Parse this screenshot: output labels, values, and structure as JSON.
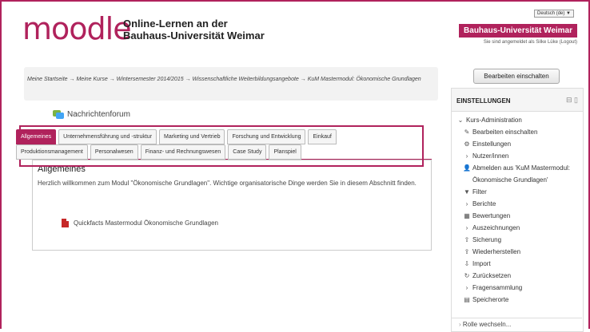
{
  "header": {
    "logo_text": "moodle",
    "logo_sub_line1": "Online-Lernen an der",
    "logo_sub_line2": "Bauhaus-Universität Weimar",
    "language": "Deutsch (de) ▼",
    "university": "Bauhaus-Universität Weimar",
    "login_info": "Sie sind angemeldet als Silke Lüke (Logout)"
  },
  "breadcrumb": {
    "text": "Meine Startseite → Meine Kurse → Wintersemester 2014/2015 → Wissenschaftliche Weiterbildungsangebote → KuM Mastermodul: Ökonomische Grundlagen"
  },
  "forum": {
    "label": "Nachrichtenforum"
  },
  "tabs": {
    "row1": [
      "Allgemeines",
      "Unternehmensführung und -struktur",
      "Marketing und Vertrieb",
      "Forschung und Entwicklung",
      "Einkauf"
    ],
    "row2": [
      "Produktionsmanagement",
      "Personalwesen",
      "Finanz- und Rechnungswesen",
      "Case Study",
      "Planspiel"
    ],
    "active": "Allgemeines"
  },
  "section": {
    "title": "Allgemeines",
    "text": "Herzlich willkommen zum Modul \"Ökonomische Grundlagen\". Wichtige organisatorische Dinge werden Sie in diesem Abschnitt finden.",
    "pdf_link": "Quickfacts Mastermodul Ökonomische Grundlagen"
  },
  "edit_button": "Bearbeiten einschalten",
  "settings": {
    "title": "EINSTELLUNGEN",
    "controls": "⊟ ▯",
    "items": [
      {
        "icon": "collapse-arrow",
        "glyph": "⌄",
        "label": "Kurs-Administration",
        "level": 0
      },
      {
        "icon": "pencil-icon",
        "glyph": "✎",
        "label": "Bearbeiten einschalten",
        "level": 1
      },
      {
        "icon": "gear-icon",
        "glyph": "⚙",
        "label": "Einstellungen",
        "level": 1
      },
      {
        "icon": "expand-arrow",
        "glyph": "›",
        "label": "Nutzer/innen",
        "level": 1
      },
      {
        "icon": "user-icon",
        "glyph": "👤",
        "label": "Abmelden aus 'KuM Mastermodul: Ökonomische Grundlagen'",
        "level": 1
      },
      {
        "icon": "filter-icon",
        "glyph": "▼",
        "label": "Filter",
        "level": 1
      },
      {
        "icon": "expand-arrow",
        "glyph": "›",
        "label": "Berichte",
        "level": 1
      },
      {
        "icon": "grades-icon",
        "glyph": "▦",
        "label": "Bewertungen",
        "level": 1
      },
      {
        "icon": "expand-arrow",
        "glyph": "›",
        "label": "Auszeichnungen",
        "level": 1
      },
      {
        "icon": "backup-icon",
        "glyph": "⇧",
        "label": "Sicherung",
        "level": 1
      },
      {
        "icon": "restore-icon",
        "glyph": "⇪",
        "label": "Wiederherstellen",
        "level": 1
      },
      {
        "icon": "import-icon",
        "glyph": "⇩",
        "label": "Import",
        "level": 1
      },
      {
        "icon": "reset-icon",
        "glyph": "↻",
        "label": "Zurücksetzen",
        "level": 1
      },
      {
        "icon": "expand-arrow",
        "glyph": "›",
        "label": "Fragensammlung",
        "level": 1
      },
      {
        "icon": "files-icon",
        "glyph": "▤",
        "label": "Speicherorte",
        "level": 1
      }
    ],
    "role_switch": "Rolle wechseln..."
  },
  "colors": {
    "accent": "#b0225c"
  }
}
